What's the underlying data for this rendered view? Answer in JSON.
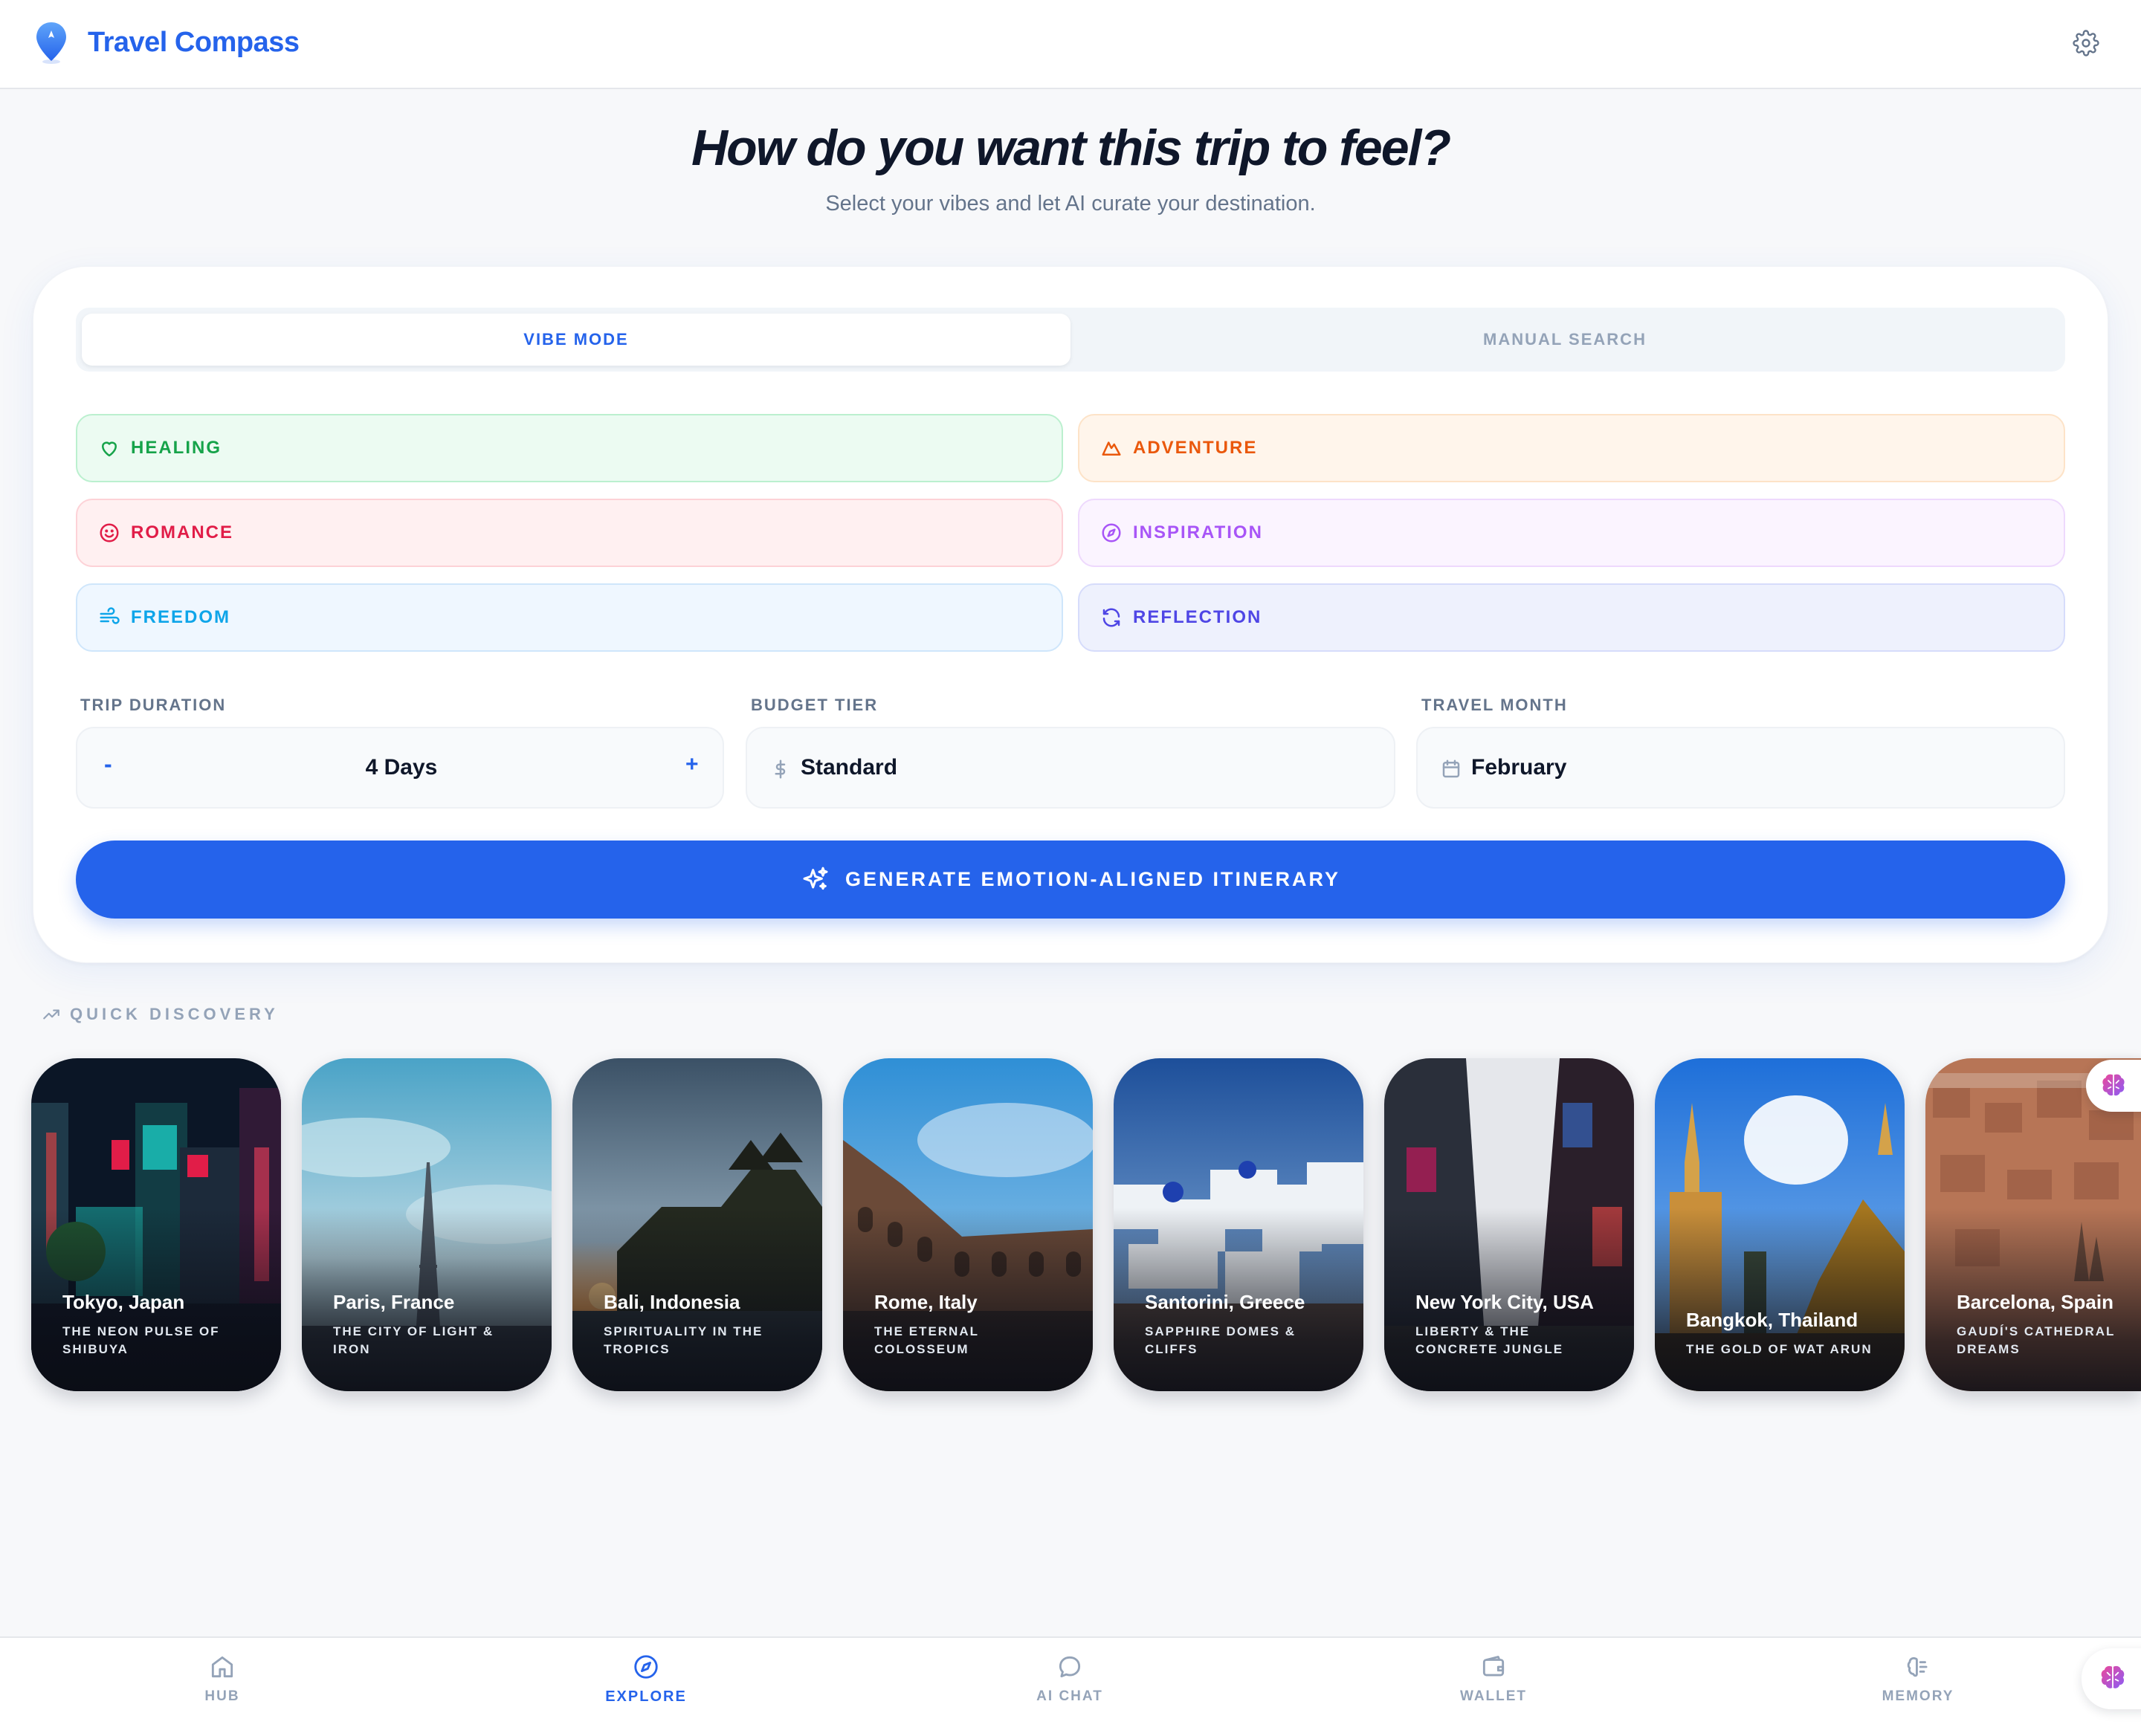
{
  "app": {
    "title": "Travel Compass"
  },
  "hero": {
    "title": "How do you want this trip to feel?",
    "subtitle": "Select your vibes and let AI curate your destination."
  },
  "mode_tabs": [
    {
      "label": "VIBE MODE",
      "active": true
    },
    {
      "label": "MANUAL SEARCH",
      "active": false
    }
  ],
  "vibes": [
    {
      "label": "HEALING",
      "icon": "heart-icon",
      "color": "#16a34a",
      "bg": "#ecfbf2",
      "border": "#bbf0cf"
    },
    {
      "label": "ADVENTURE",
      "icon": "mountain-icon",
      "color": "#ea580c",
      "bg": "#fff5eb",
      "border": "#fde3c8"
    },
    {
      "label": "ROMANCE",
      "icon": "smile-icon",
      "color": "#e11d48",
      "bg": "#fff0f1",
      "border": "#fdd2d7"
    },
    {
      "label": "INSPIRATION",
      "icon": "compass-icon",
      "color": "#a855f7",
      "bg": "#fbf4ff",
      "border": "#eed9fd"
    },
    {
      "label": "FREEDOM",
      "icon": "wind-icon",
      "color": "#0ea5e9",
      "bg": "#eff7ff",
      "border": "#cfe6fb"
    },
    {
      "label": "REFLECTION",
      "icon": "refresh-icon",
      "color": "#4f46e5",
      "bg": "#eef1fd",
      "border": "#d6dcfb"
    }
  ],
  "trip": {
    "duration_label": "TRIP DURATION",
    "duration_value": "4 Days",
    "decrement": "-",
    "increment": "+",
    "budget_label": "BUDGET TIER",
    "budget_value": "Standard",
    "month_label": "TRAVEL MONTH",
    "month_value": "February"
  },
  "generate_label": "GENERATE EMOTION-ALIGNED ITINERARY",
  "quick_discovery": {
    "label": "QUICK DISCOVERY",
    "destinations": [
      {
        "name": "Tokyo, Japan",
        "tagline": "THE NEON PULSE OF SHIBUYA"
      },
      {
        "name": "Paris, France",
        "tagline": "THE CITY OF LIGHT & IRON"
      },
      {
        "name": "Bali, Indonesia",
        "tagline": "SPIRITUALITY IN THE TROPICS"
      },
      {
        "name": "Rome, Italy",
        "tagline": "THE ETERNAL COLOSSEUM"
      },
      {
        "name": "Santorini, Greece",
        "tagline": "SAPPHIRE DOMES & CLIFFS"
      },
      {
        "name": "New York City, USA",
        "tagline": "LIBERTY & THE CONCRETE JUNGLE"
      },
      {
        "name": "Bangkok, Thailand",
        "tagline": "THE GOLD OF WAT ARUN"
      },
      {
        "name": "Barcelona, Spain",
        "tagline": "GAUDÍ'S CATHEDRAL DREAMS"
      }
    ]
  },
  "nav": [
    {
      "label": "HUB",
      "icon": "home-icon",
      "active": false
    },
    {
      "label": "EXPLORE",
      "icon": "compass-icon",
      "active": true
    },
    {
      "label": "AI CHAT",
      "icon": "chat-bubble-icon",
      "active": false
    },
    {
      "label": "WALLET",
      "icon": "wallet-icon",
      "active": false
    },
    {
      "label": "MEMORY",
      "icon": "brain-icon",
      "active": false
    }
  ],
  "colors": {
    "accent": "#2563eb",
    "background": "#f7f8fa",
    "muted": "#94a3b8"
  }
}
